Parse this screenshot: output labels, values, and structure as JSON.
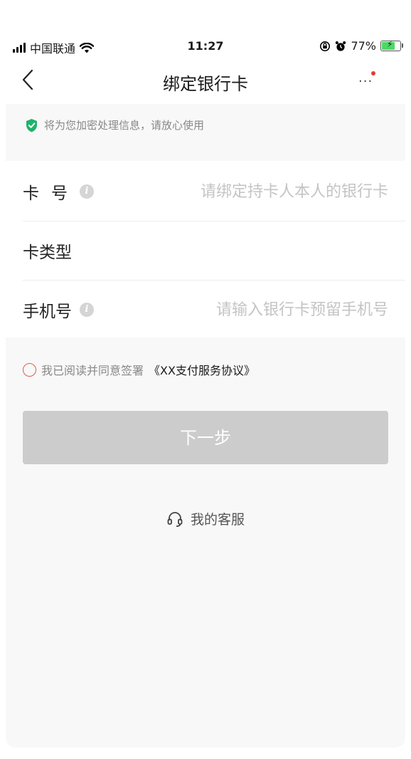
{
  "status_bar": {
    "carrier": "中国联通",
    "time": "11:27",
    "battery_percent": "77%",
    "battery_level": 0.77,
    "icons": [
      "signal-icon",
      "wifi-icon",
      "orientation-lock-icon",
      "alarm-icon",
      "battery-charging-icon"
    ]
  },
  "nav": {
    "title": "绑定银行卡",
    "back_icon": "chevron-left-icon",
    "more_icon": "more-dots-icon"
  },
  "notice": {
    "icon": "shield-check-icon",
    "text": "将为您加密处理信息，请放心使用"
  },
  "form": {
    "card_number": {
      "label": "卡号",
      "label_chars": [
        "卡",
        "号"
      ],
      "value": "",
      "placeholder": "请绑定持卡人本人的银行卡"
    },
    "card_type": {
      "label": "卡类型",
      "value": ""
    },
    "phone": {
      "label": "手机号",
      "value": "",
      "placeholder": "请输入银行卡预留手机号"
    }
  },
  "agreement": {
    "checked": false,
    "prefix": "我已阅读并同意签署",
    "link": "《XX支付服务协议》"
  },
  "next_button": {
    "label": "下一步",
    "enabled": false
  },
  "service": {
    "icon": "headset-icon",
    "label": "我的客服"
  },
  "colors": {
    "accent_red": "#e05a4e",
    "shield_green": "#1fb36a",
    "button_disabled": "#cccccc",
    "placeholder": "#c4c4c4",
    "background": "#f8f8f8"
  }
}
